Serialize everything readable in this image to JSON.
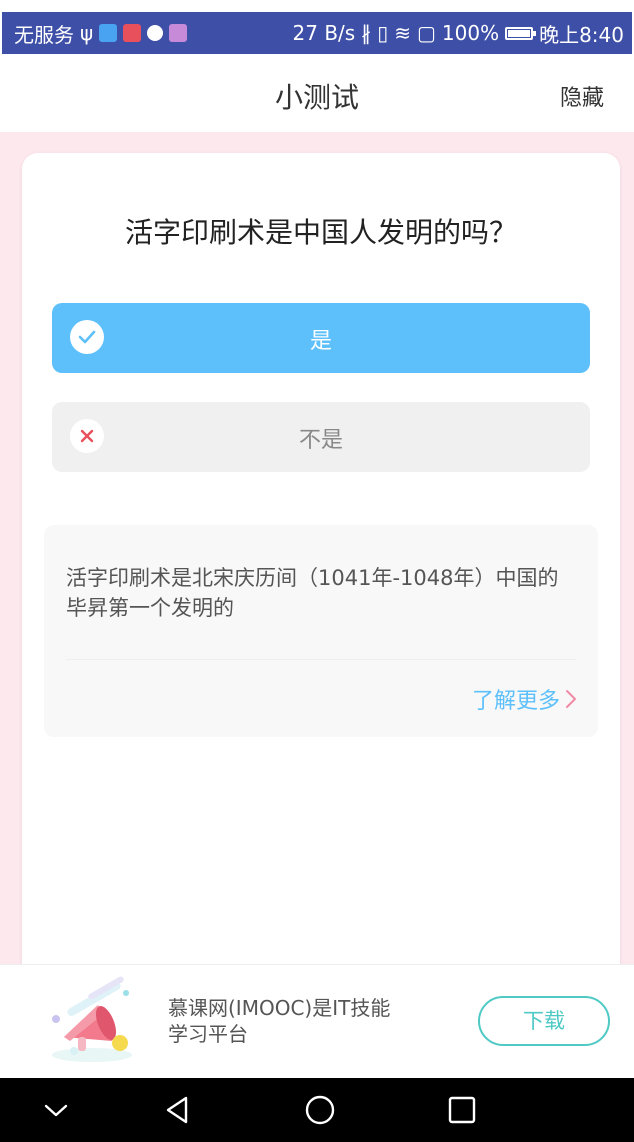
{
  "status_bar": {
    "carrier": "无服务",
    "net_speed": "27 B/s",
    "battery": "100%",
    "time": "晚上8:40"
  },
  "header": {
    "title": "小测试",
    "hide_label": "隐藏"
  },
  "quiz": {
    "question": "活字印刷术是中国人发明的吗？",
    "options": [
      {
        "label": "是",
        "selected": true,
        "icon": "check-icon"
      },
      {
        "label": "不是",
        "selected": false,
        "icon": "cross-icon"
      }
    ],
    "explanation": "活字印刷术是北宋庆历间（1041年-1048年）中国的毕昇第一个发明的",
    "learn_more": "了解更多"
  },
  "ad": {
    "text": "慕课网(IMOOC)是IT技能学习平台",
    "download_label": "下载"
  },
  "colors": {
    "status_bar": "#3d4fa6",
    "accent_blue": "#5ec0fb",
    "page_pink": "#fde8ee",
    "download_teal": "#4ec9c4",
    "wrong_red": "#e8505b"
  }
}
